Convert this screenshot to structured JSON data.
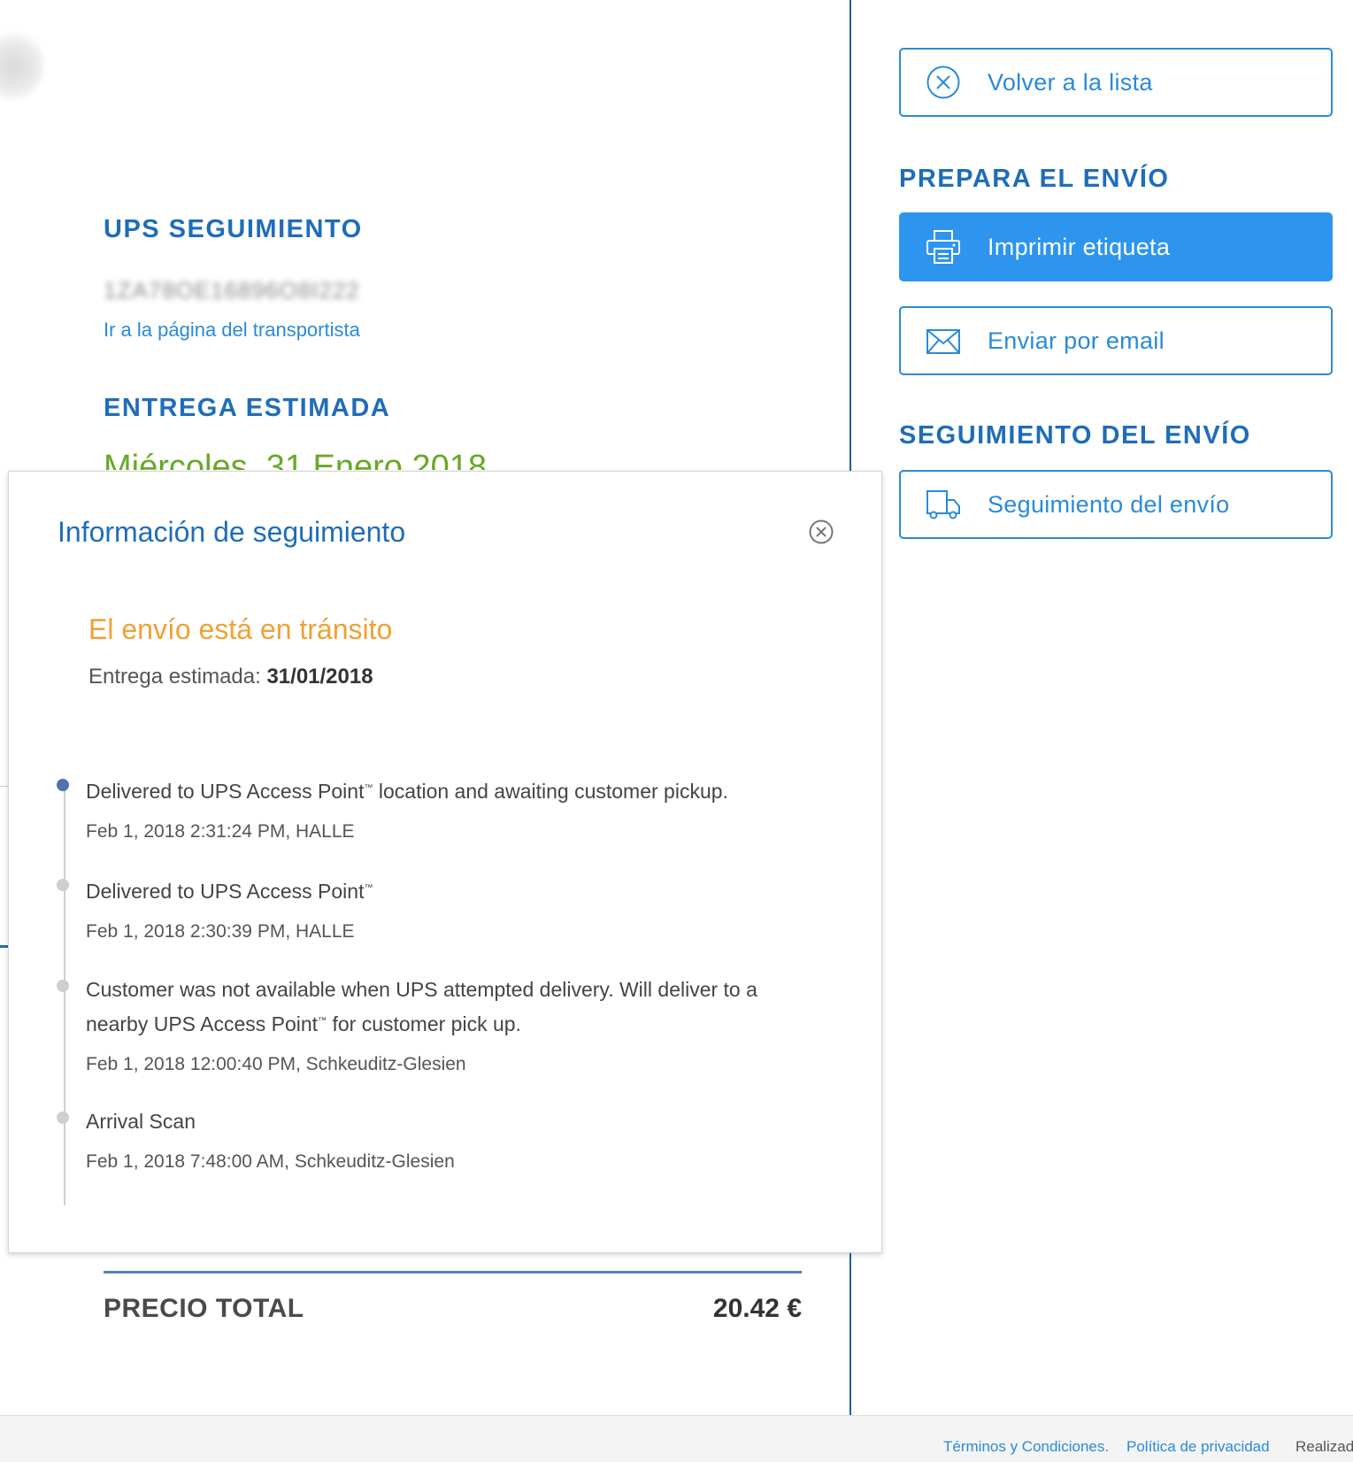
{
  "left": {
    "tracking_heading": "UPS SEGUIMIENTO",
    "tracking_number": "1ZA78OE16896O8I222",
    "carrier_link": "Ir a la página del transportista",
    "estimated_heading": "ENTREGA ESTIMADA",
    "estimated_date": "Miércoles, 31 Enero 2018",
    "total_label": "PRECIO TOTAL",
    "total_value": "20.42 €"
  },
  "right": {
    "back_button": "Volver a la lista",
    "prepare_heading": "PREPARA EL ENVÍO",
    "print_button": "Imprimir etiqueta",
    "email_button": "Enviar por email",
    "tracking_heading": "SEGUIMIENTO DEL ENVÍO",
    "tracking_button": "Seguimiento del envío"
  },
  "modal": {
    "title": "Información de seguimiento",
    "status": "El envío está en tránsito",
    "eta_label": "Entrega estimada:",
    "eta_value": "31/01/2018",
    "events": [
      {
        "desc": "Delivered to UPS Access Point",
        "desc_tm": "™",
        "desc_after": " location and awaiting customer pickup.",
        "meta": "Feb 1, 2018 2:31:24 PM, HALLE"
      },
      {
        "desc": "Delivered to UPS Access Point",
        "desc_tm": "™",
        "desc_after": "",
        "meta": "Feb 1, 2018 2:30:39 PM, HALLE"
      },
      {
        "desc": "Customer was not available when UPS attempted delivery. Will deliver to a nearby UPS Access Point",
        "desc_tm": "™",
        "desc_after": " for customer pick up.",
        "meta": "Feb 1, 2018 12:00:40 PM, Schkeuditz-Glesien"
      },
      {
        "desc": "Arrival Scan",
        "desc_tm": "",
        "desc_after": "",
        "meta": "Feb 1, 2018 7:48:00 AM, Schkeuditz-Glesien"
      }
    ]
  },
  "footer": {
    "terms": "Términos y Condiciones.",
    "privacy": "Política de privacidad",
    "credit": "Realizad"
  },
  "colors": {
    "heading_blue": "#1f6db8",
    "link_blue": "#2a8ad9",
    "primary_button": "#2d95ee",
    "status_orange": "#f0a135",
    "date_green": "#6aa827",
    "timeline_active": "#4f74ad"
  }
}
